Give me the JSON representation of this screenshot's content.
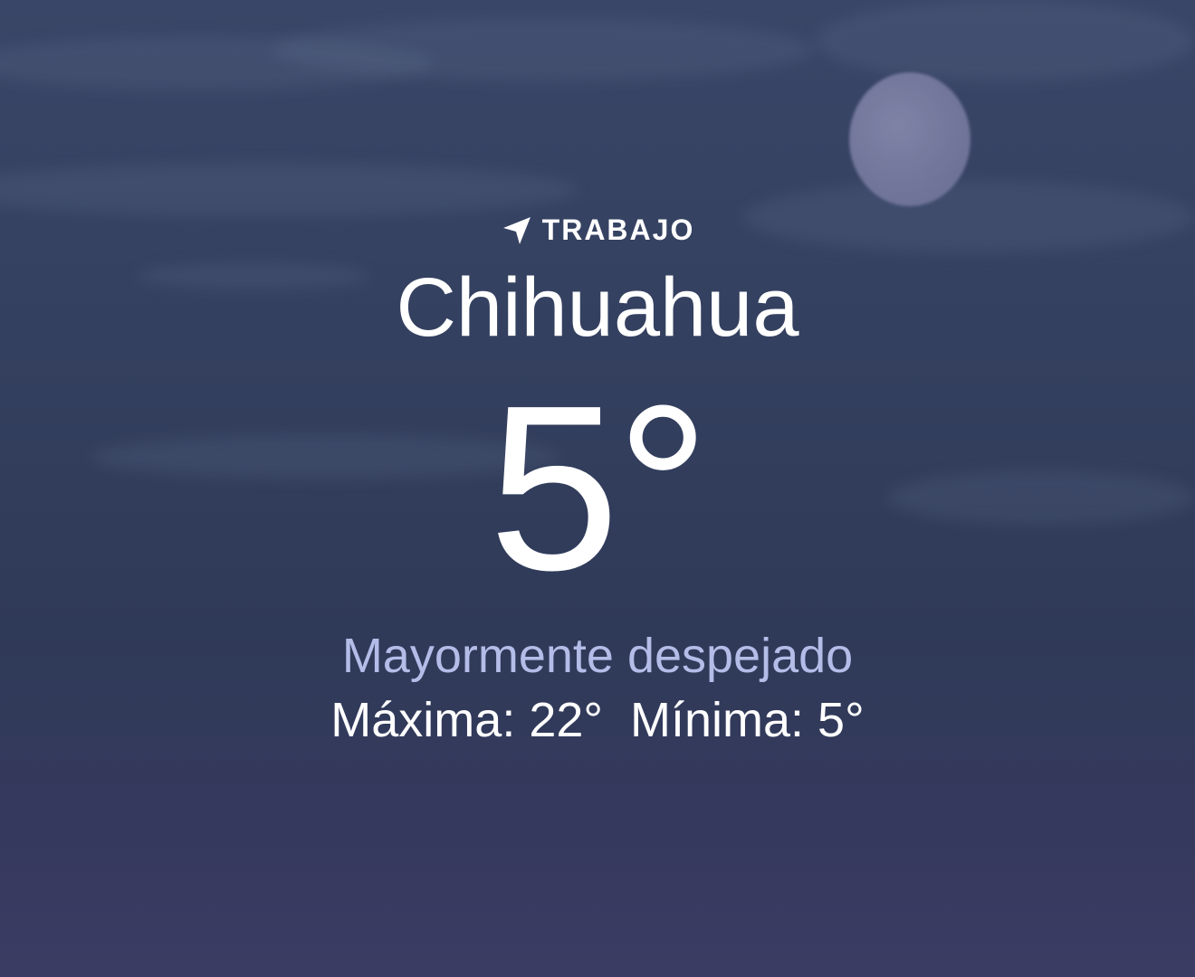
{
  "location": {
    "label": "TRABAJO",
    "icon": "location-arrow-icon",
    "city": "Chihuahua"
  },
  "current": {
    "temperature": "5°",
    "condition": "Mayormente despejado",
    "high_label": "Máxima: 22°",
    "low_label": "Mínima: 5°"
  },
  "colors": {
    "background": "#34405f",
    "condition_text": "#b3bde8",
    "primary_text": "#ffffff"
  }
}
